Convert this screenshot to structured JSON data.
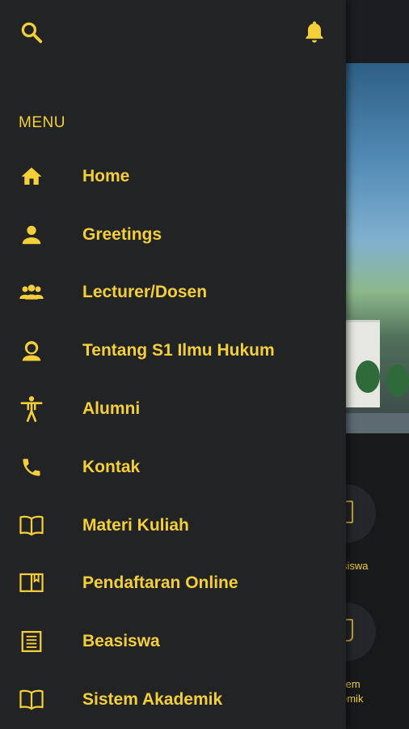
{
  "colors": {
    "accent": "#f4cf3a",
    "drawer_bg": "#222325",
    "background": "#18191b"
  },
  "drawer": {
    "top_icons": {
      "search": "search-icon",
      "notifications": "bell-icon"
    },
    "menu_heading": "MENU",
    "items": [
      {
        "label": "Home",
        "icon": "home-icon"
      },
      {
        "label": "Greetings",
        "icon": "person-icon"
      },
      {
        "label": "Lecturer/Dosen",
        "icon": "group-icon"
      },
      {
        "label": "Tentang S1 Ilmu Hukum",
        "icon": "face-icon"
      },
      {
        "label": "Alumni",
        "icon": "accessibility-icon"
      },
      {
        "label": "Kontak",
        "icon": "phone-icon"
      },
      {
        "label": "Materi Kuliah",
        "icon": "book-open-icon"
      },
      {
        "label": "Pendaftaran Online",
        "icon": "book-bookmark-icon"
      },
      {
        "label": "Beasiswa",
        "icon": "document-list-icon"
      },
      {
        "label": "Sistem Akademik",
        "icon": "book-open-icon"
      }
    ]
  },
  "background_app": {
    "labels": [
      "siswa",
      "tem",
      "emik"
    ]
  }
}
